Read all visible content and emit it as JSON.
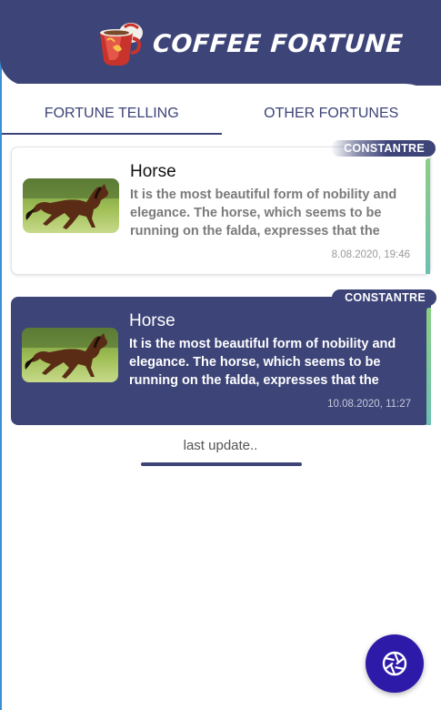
{
  "app": {
    "title": "COFFEE FORTUNE",
    "logo_icon": "coffee-cup-icon"
  },
  "tabs": [
    {
      "label": "FORTUNE TELLING",
      "active": true
    },
    {
      "label": "OTHER FORTUNES",
      "active": false
    }
  ],
  "fortunes": [
    {
      "badge": "CONSTANTRE",
      "title": "Horse",
      "description": "It is the most beautiful form of nobility and elegance. The horse, which seems to be running on the falda, expresses that the",
      "date": "8.08.2020, 19:46",
      "image": "horse-image",
      "highlighted": false
    },
    {
      "badge": "CONSTANTRE",
      "title": "Horse",
      "description": "It is the most beautiful form of nobility and elegance. The horse, which seems to be running on the falda, expresses that the",
      "date": "10.08.2020, 11:27",
      "image": "horse-image",
      "highlighted": true
    }
  ],
  "status": {
    "last_update": "last update.."
  },
  "fab": {
    "icon": "camera-aperture-icon"
  },
  "colors": {
    "primary": "#3d4478",
    "accent_green": "#8bcf82",
    "fab": "#2e1aa8"
  }
}
